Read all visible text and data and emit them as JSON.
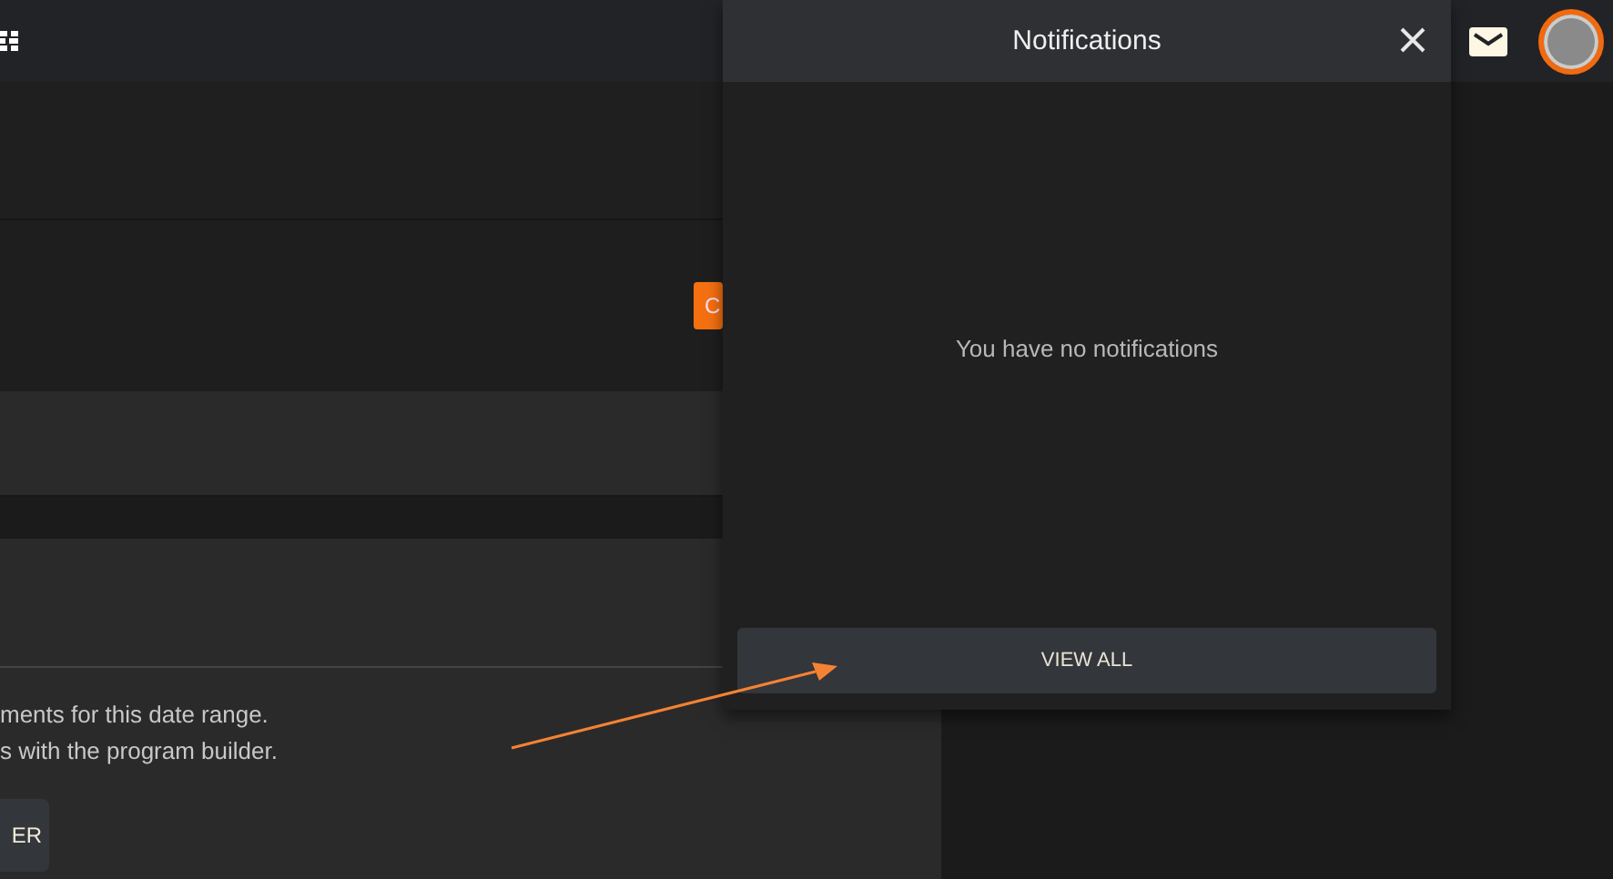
{
  "notifications": {
    "title": "Notifications",
    "empty_message": "You have no notifications",
    "view_all_button": "VIEW ALL"
  },
  "toolbar_button": "C",
  "empty_state": {
    "lines": [
      "ments for this date range.",
      "s with the program builder."
    ],
    "button": "ER"
  }
}
